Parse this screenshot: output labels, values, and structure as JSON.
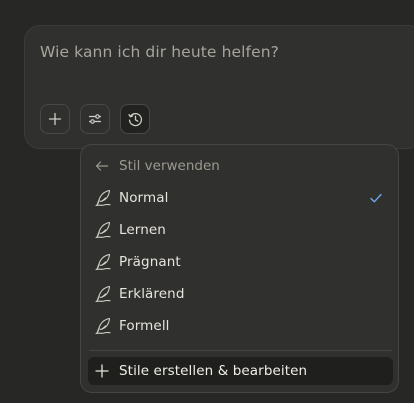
{
  "composer": {
    "placeholder": "Wie kann ich dir heute helfen?",
    "buttons": [
      {
        "icon": "plus-icon"
      },
      {
        "icon": "sliders-icon"
      },
      {
        "icon": "clock-history-icon"
      }
    ]
  },
  "style_menu": {
    "back_label": "Stil verwenden",
    "items": [
      {
        "label": "Normal",
        "icon": "feather-icon",
        "selected": true
      },
      {
        "label": "Lernen",
        "icon": "feather-icon",
        "selected": false
      },
      {
        "label": "Prägnant",
        "icon": "feather-icon",
        "selected": false
      },
      {
        "label": "Erklärend",
        "icon": "feather-icon",
        "selected": false
      },
      {
        "label": "Formell",
        "icon": "feather-icon",
        "selected": false
      }
    ],
    "create_label": "Stile erstellen & bearbeiten"
  },
  "colors": {
    "background": "#272725",
    "surface": "#30302e",
    "check_accent": "#6ea6e6"
  }
}
